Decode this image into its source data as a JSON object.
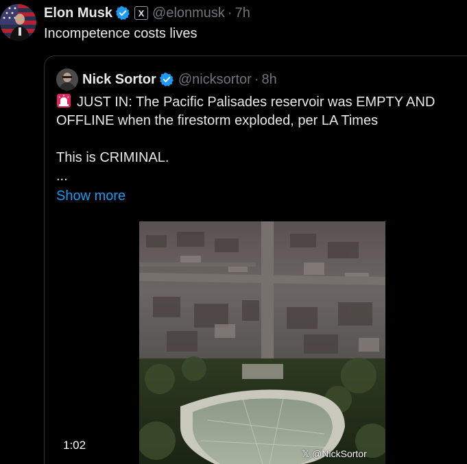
{
  "outer_tweet": {
    "name": "Elon Musk",
    "handle": "@elonmusk",
    "separator": "·",
    "time": "7h",
    "text": "Incompetence costs lives",
    "badge_label": "X"
  },
  "quoted_tweet": {
    "name": "Nick Sortor",
    "handle": "@nicksortor",
    "separator": "·",
    "time": "8h",
    "line1": "JUST IN: The Pacific Palisades reservoir was EMPTY AND OFFLINE when the firestorm exploded, per LA Times",
    "line2": "This is CRIMINAL.",
    "line3": "...",
    "show_more": "Show more"
  },
  "video": {
    "duration": "1:02",
    "watermark": "𝕏 @NickSortor"
  },
  "colors": {
    "background": "#000000",
    "text": "#e7e9ea",
    "muted": "#71767b",
    "link": "#1d9bf0",
    "verified": "#1d9bf0",
    "border": "#2f3336"
  },
  "icons": {
    "verified": "verified-badge-icon",
    "x_badge": "x-affiliate-icon",
    "siren": "siren-emoji-icon"
  }
}
